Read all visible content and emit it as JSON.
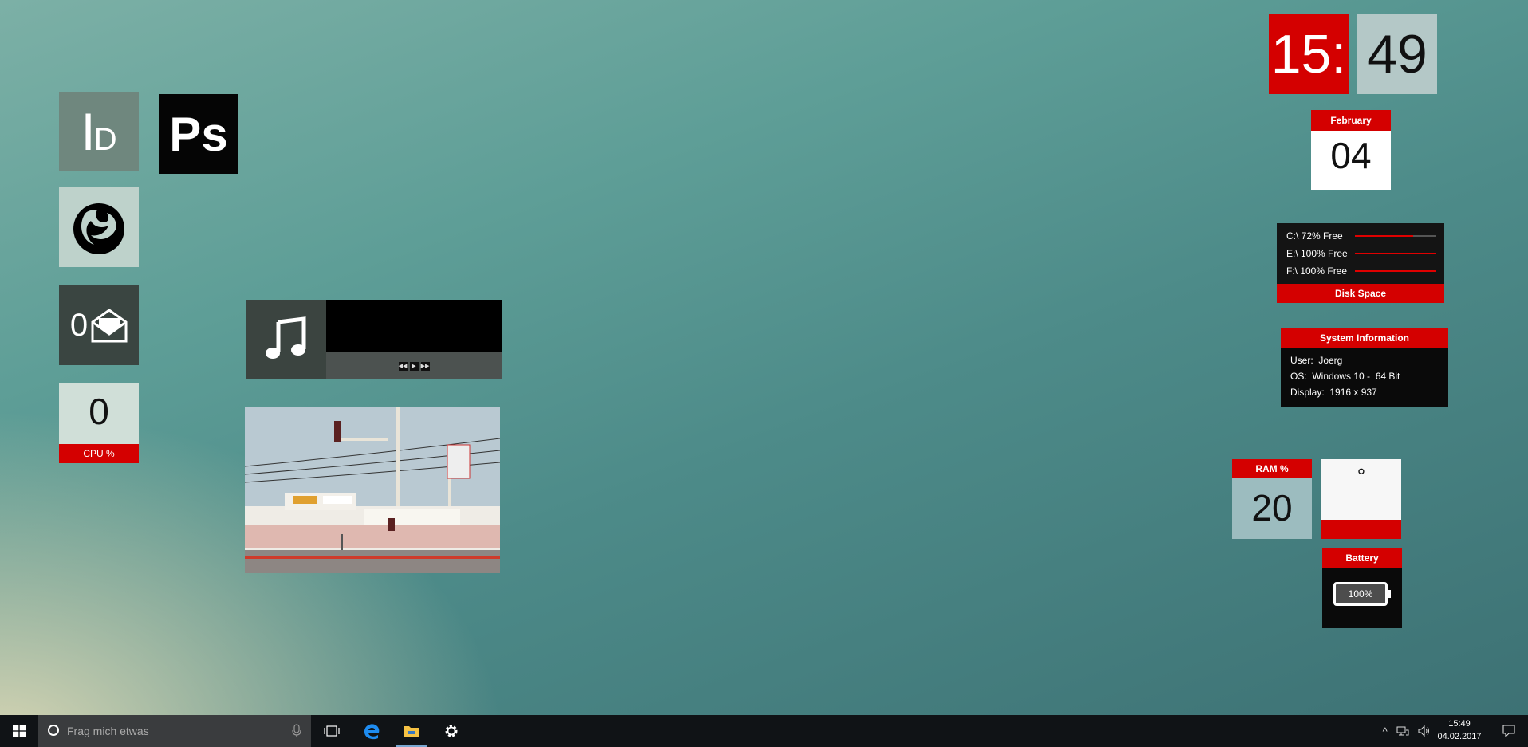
{
  "desktop": {
    "tiles": {
      "indesign_label": "ID",
      "indesign_l1": "I",
      "indesign_l2": "D",
      "photoshop_label": "Ps",
      "mail_count": "0",
      "cpu_value": "0",
      "cpu_label": "CPU %"
    },
    "clock": {
      "hours": "15:",
      "minutes": "49"
    },
    "date": {
      "month": "February",
      "day": "04"
    },
    "disk": {
      "title": "Disk Space",
      "drives": [
        {
          "label": "C:\\  72% Free",
          "free_percent": 72
        },
        {
          "label": "E:\\  100% Free",
          "free_percent": 100
        },
        {
          "label": "F:\\  100% Free",
          "free_percent": 100
        }
      ]
    },
    "sysinfo": {
      "title": "System Information",
      "user": "User:  Joerg",
      "os": "OS:  Windows 10 -  64 Bit",
      "display": "Display:  1916 x 937"
    },
    "ram": {
      "label": "RAM %",
      "value": "20"
    },
    "temperature": {
      "value": "°"
    },
    "battery": {
      "label": "Battery",
      "value": "100%"
    }
  },
  "taskbar": {
    "search_placeholder": "Frag mich etwas",
    "time": "15:49",
    "date": "04.02.2017",
    "icons": [
      "windows-icon",
      "cortana-icon",
      "microphone-icon",
      "task-view-icon",
      "edge-icon",
      "file-explorer-icon",
      "settings-icon",
      "chevron-up-icon",
      "network-icon",
      "volume-icon",
      "notification-icon"
    ]
  },
  "colors": {
    "accent": "#d40000",
    "taskbar": "#101316"
  }
}
